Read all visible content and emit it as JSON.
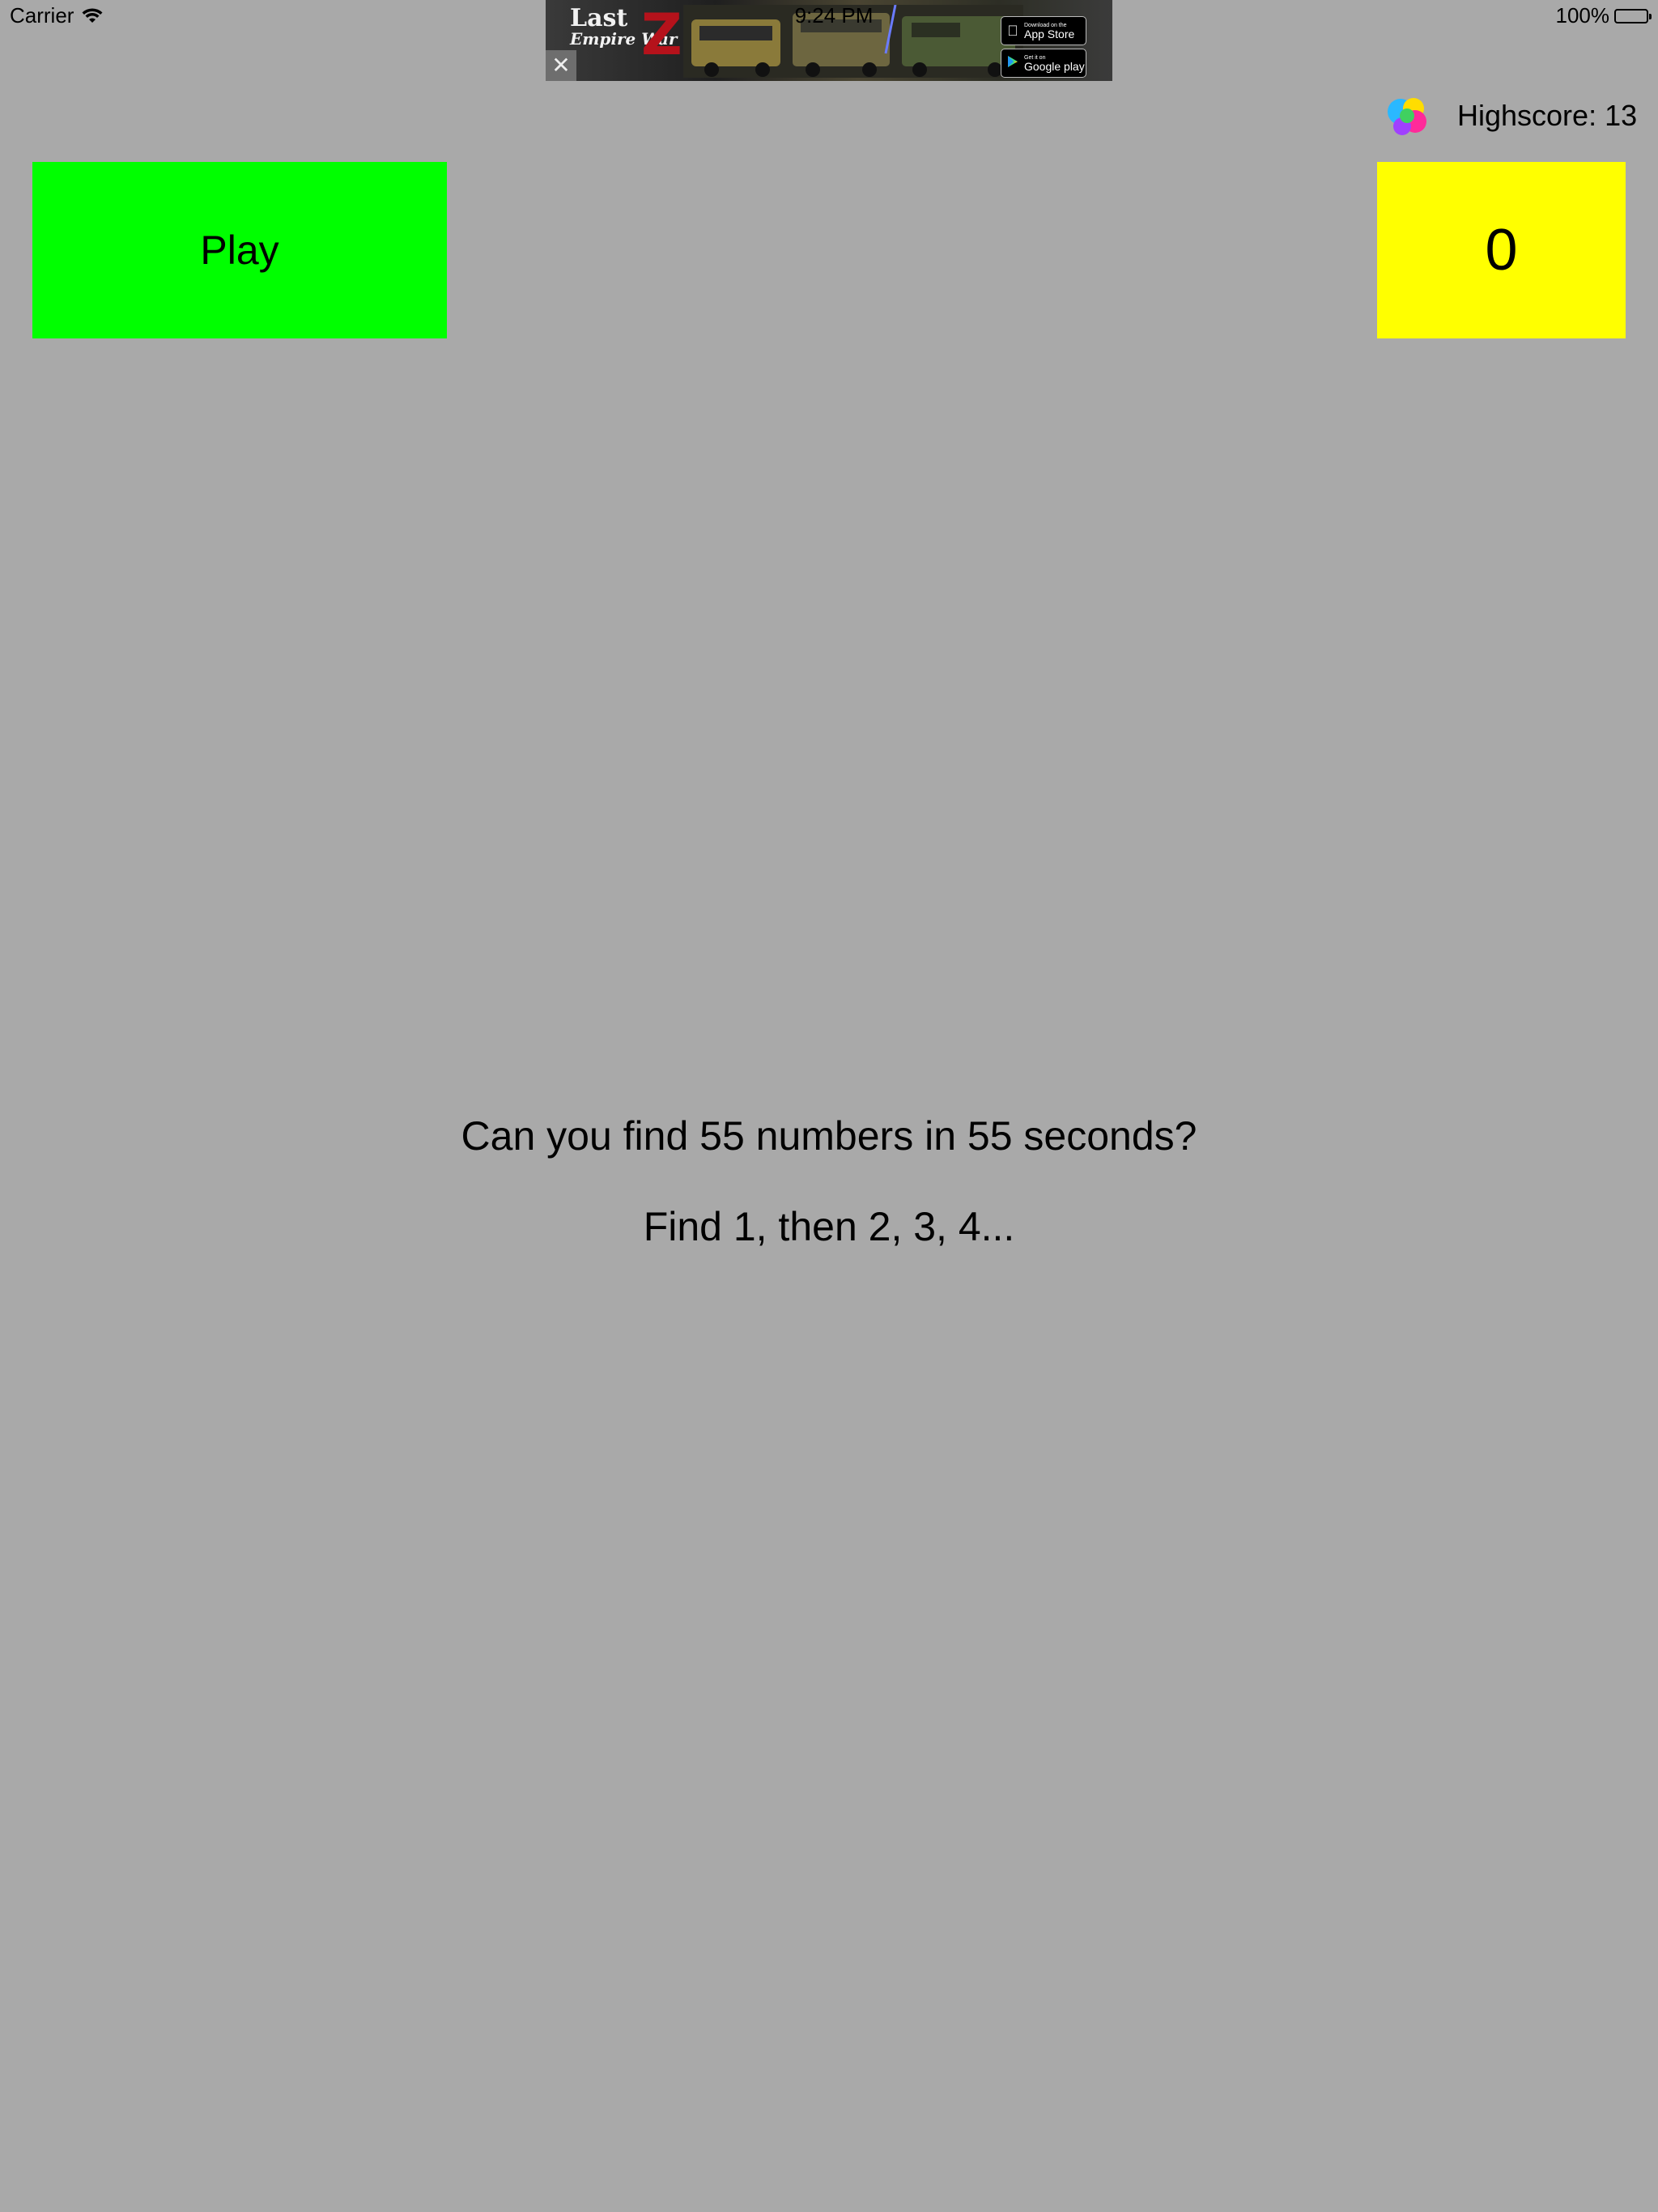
{
  "status_bar": {
    "carrier": "Carrier",
    "time": "9:24 PM",
    "battery": "100%"
  },
  "ad": {
    "logo_line1": "Last",
    "logo_line2": "Empire War",
    "logo_letter": "Z",
    "close_label": "✕",
    "appstore_small": "Download on the",
    "appstore_big": "App Store",
    "google_small": "Get it on",
    "google_big": "Google play"
  },
  "header": {
    "highscore": "Highscore: 13"
  },
  "controls": {
    "play_label": "Play",
    "score": "0"
  },
  "instructions": {
    "line1": "Can you find 55 numbers in 55 seconds?",
    "line2": "Find 1, then 2, 3, 4..."
  },
  "colors": {
    "background": "#a9a9a9",
    "play_button": "#00ff00",
    "score_box": "#ffff00"
  }
}
